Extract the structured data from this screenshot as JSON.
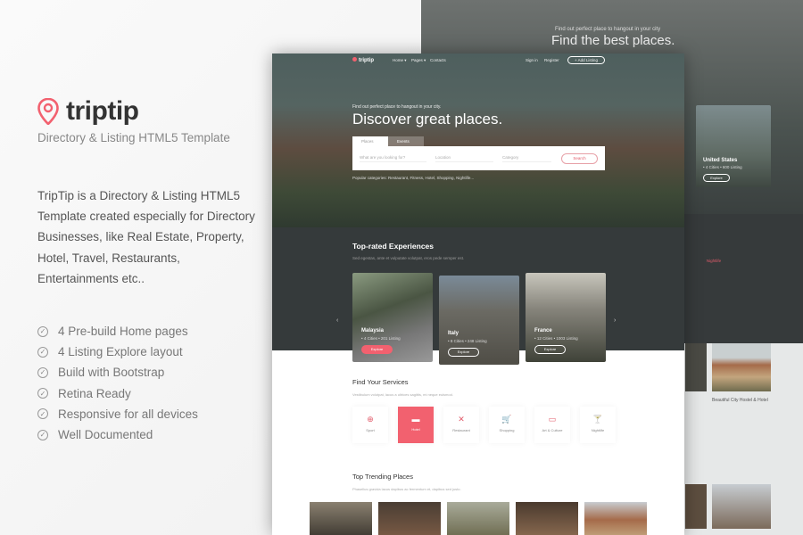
{
  "brand": {
    "name": "triptip",
    "tagline": "Directory & Listing  HTML5  Template",
    "accent": "#f2616f"
  },
  "description": "TripTip is a Directory & Listing HTML5  Template   created especially for Directory Businesses, like Real Estate, Property, Hotel, Travel, Restaurants, Entertainments etc..",
  "features": [
    "4 Pre-build Home pages",
    "4 Listing Explore layout",
    "Build with Bootstrap",
    "Retina Ready",
    "Responsive for all devices",
    "Well Documented"
  ],
  "background_preview": {
    "title": "Find the best places.",
    "subtitle": "Find out perfect place to hangout in your city",
    "country": "United States",
    "country_stats": "• 4 Cities • 600 Listing",
    "explore": "Explore",
    "service": "Nightlife",
    "hotel": "Beautiful City Hostel & Hotel"
  },
  "mockup": {
    "nav": {
      "logo": "triptip",
      "items": [
        "Home ▾",
        "Pages ▾",
        "Contacts"
      ],
      "sign_in": "Sign in",
      "register": "Register",
      "add_listing": "+ Add Listing"
    },
    "hero": {
      "subtitle": "Find out perfect place to hangout in your city.",
      "title": "Discover great places.",
      "tabs": [
        "Places",
        "Events"
      ],
      "search_placeholder": "What are you looking for?",
      "location_placeholder": "Location",
      "category_placeholder": "Category",
      "search_button": "Search",
      "popular": "Popular categories: Restaurant, Fitness, Hotel, Shopping, Nightlife..."
    },
    "experiences": {
      "title": "Top-rated Experiences",
      "subtitle": "Sed egestas, ante et vulputate volutpat, eros pede semper est.",
      "cards": [
        {
          "name": "Malaysia",
          "stats": "• 4 Cities • 201 Listing",
          "button": "Explore"
        },
        {
          "name": "Italy",
          "stats": "• 8 Cities • 248 Listing",
          "button": "Explore"
        },
        {
          "name": "France",
          "stats": "• 12 Cities • 1003 Listing",
          "button": "Explore"
        }
      ]
    },
    "services": {
      "title": "Find Your Services",
      "subtitle": "Vestibulum volutpat, lacus a ultrices sagittis, mi neque euismod.",
      "items": [
        {
          "label": "Sport",
          "icon": "⊕"
        },
        {
          "label": "Hotel",
          "icon": "▬",
          "active": true
        },
        {
          "label": "Restaurant",
          "icon": "✕"
        },
        {
          "label": "Shopping",
          "icon": "🛒"
        },
        {
          "label": "Art & Culture",
          "icon": "▭"
        },
        {
          "label": "Nightlife",
          "icon": "🍸"
        }
      ]
    },
    "trending": {
      "title": "Top Trending Places",
      "subtitle": "Phasellus gravida lacus dapibus ac fermentum et, dapibus sed justo."
    }
  }
}
